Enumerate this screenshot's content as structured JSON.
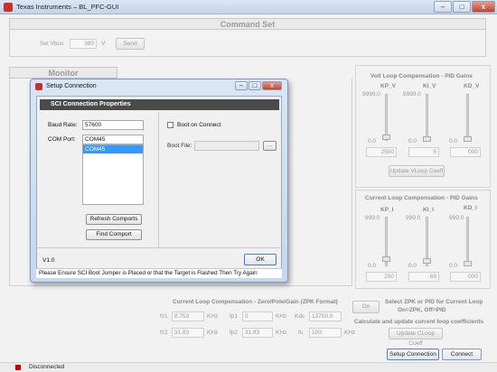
{
  "window": {
    "title": "Texas Instruments – BL_PFC-GUI",
    "min": "–",
    "max": "□",
    "close": "x"
  },
  "command": {
    "header": "Command Set",
    "vbus_label": "Set Vbus",
    "vbus_value": "383",
    "vbus_unit": "V",
    "send_label": "Send"
  },
  "monitor": {
    "header": "Monitor"
  },
  "volt_pid": {
    "title": "Volt Loop Compensation - PID Gains",
    "kp_label": "KP_V",
    "ki_label": "KI_V",
    "kd_label": "KD_V",
    "kp_max": "9999.0",
    "ki_max": "9999.0",
    "kp_min": "0.0",
    "ki_min": "0.0",
    "kd_min": "0.0",
    "kp_value": "2500",
    "ki_value": "5",
    "kd_value": "000",
    "update_label": "Update VLoop Coeff"
  },
  "curr_pid": {
    "title": "Current Loop Compensation - PID Gains",
    "kp_label": "KP_I",
    "ki_label": "KI_I",
    "kd_label": "KD_I",
    "kp_max": "999.0",
    "ki_max": "999.0",
    "kd_max": "999.0",
    "kp_min": "0.0",
    "ki_min": "0.0",
    "kd_min": "0.0",
    "kp_value": "250",
    "ki_value": "69",
    "kd_value": "000"
  },
  "zpk": {
    "title": "Current Loop Compensation - Zero/Pole/Gain (ZPK Format)",
    "fz1_label": "fz1",
    "fz1_value": "8.753",
    "fz1_unit": "KHz",
    "fp1_label": "fp1",
    "fp1_value": "0",
    "fp1_unit": "KHz",
    "kdc_label": "Kdc",
    "kdc_value": "13750.0",
    "fz2_label": "fz2",
    "fz2_value": "31.83",
    "fz2_unit": "KHz",
    "fp2_label": "fp2",
    "fp2_value": "31.83",
    "fp2_unit": "KHz",
    "fs_label": "fs",
    "fs_value": "100",
    "fs_unit": "KHz"
  },
  "zpk_select": {
    "toggle_label": "On",
    "text1": "Select ZPK or PID for Current Loop",
    "text2": "On=ZPK, Off=PID",
    "calc_text": "Calculate and update current loop coefficients",
    "update_label": "Update CLoop Coeff"
  },
  "actions": {
    "setup_label": "Setup Connection",
    "connect_label": "Connect"
  },
  "status": {
    "text": "Disconnected",
    "color": "#cc0000"
  },
  "dialog": {
    "title": "Setup Connection",
    "header": "SCI Connection Properties",
    "baud_label": "Baud Rate:",
    "baud_value": "57600",
    "port_label": "COM Port:",
    "port_value": "COM45",
    "port_list": [
      "COM45"
    ],
    "refresh_label": "Refresh Comports",
    "find_label": "Find Comport",
    "boot_on_connect_label": "Boot on Connect",
    "boot_file_label": "Boot File:",
    "browse_label": "...",
    "version": "V1.0",
    "ok_label": "OK",
    "footer": "Please Ensure SCI Boot Jumper is Placed or that the Target is Flashed Then Try Again"
  }
}
